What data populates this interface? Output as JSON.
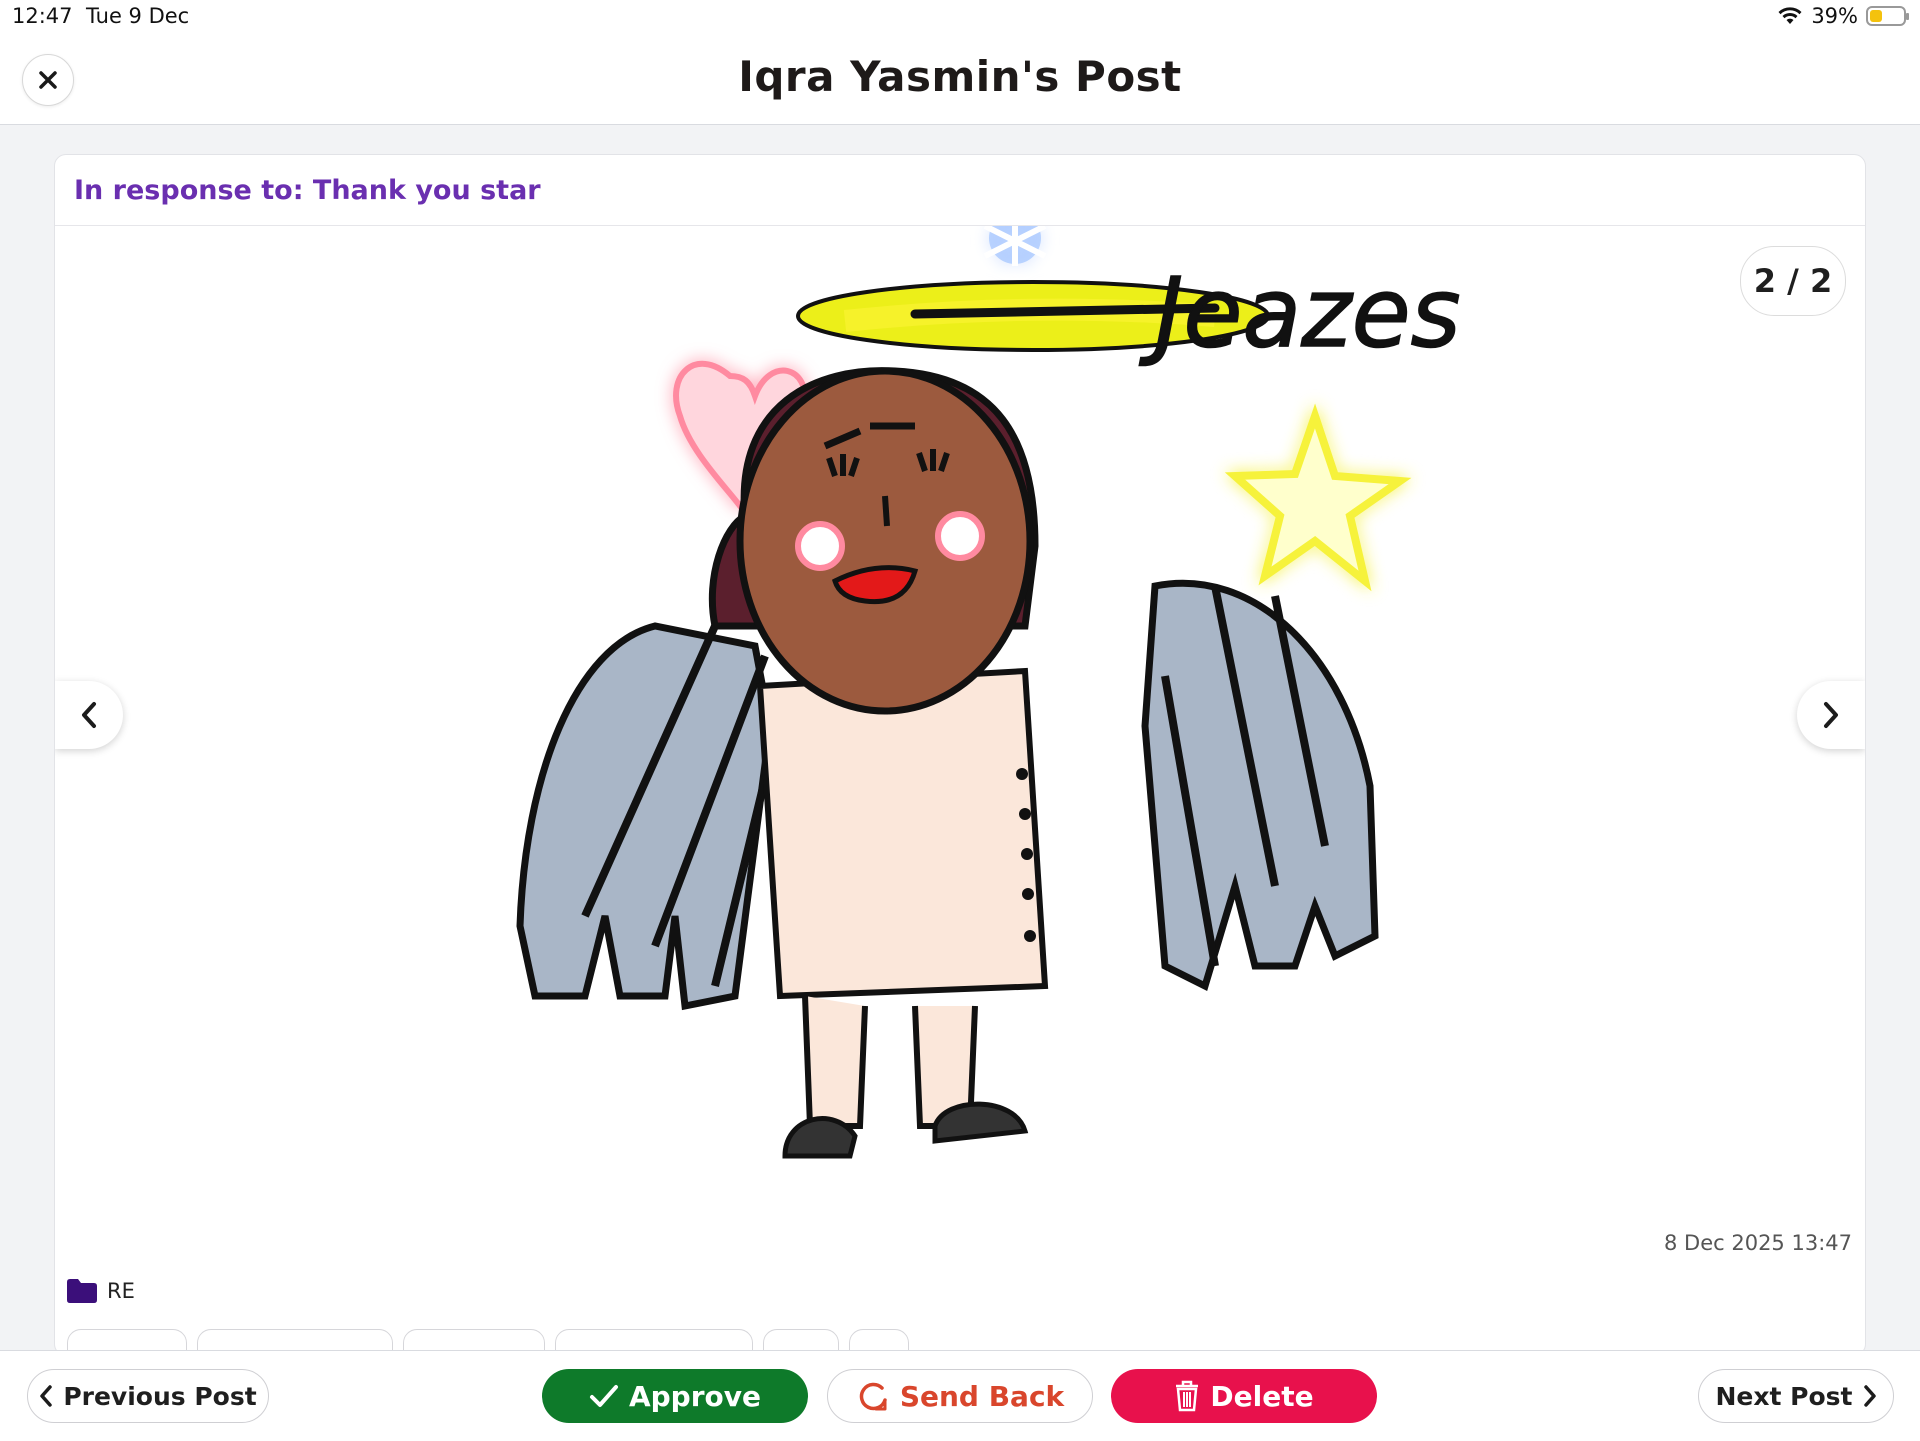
{
  "status_bar": {
    "time": "12:47",
    "date": "Tue 9 Dec",
    "battery": "39%",
    "battery_level": 0.39
  },
  "header": {
    "title": "Iqra Yasmin's Post",
    "close_icon": "close-icon"
  },
  "post": {
    "response_text": "In response to: Thank you star",
    "page_counter": "2 / 2",
    "drawing_text": "Jeazes",
    "timestamp": "8 Dec 2025 13:47",
    "folder": "RE"
  },
  "toolbar": {
    "previous_post": "Previous Post",
    "approve": "Approve",
    "send_back": "Send Back",
    "delete": "Delete",
    "next_post": "Next Post"
  },
  "colors": {
    "accent_purple": "#6a2fb0",
    "approve_green": "#0e7a2a",
    "delete_red": "#e8114c",
    "send_back_orange": "#d9462c",
    "folder": "#3b0f7a"
  }
}
